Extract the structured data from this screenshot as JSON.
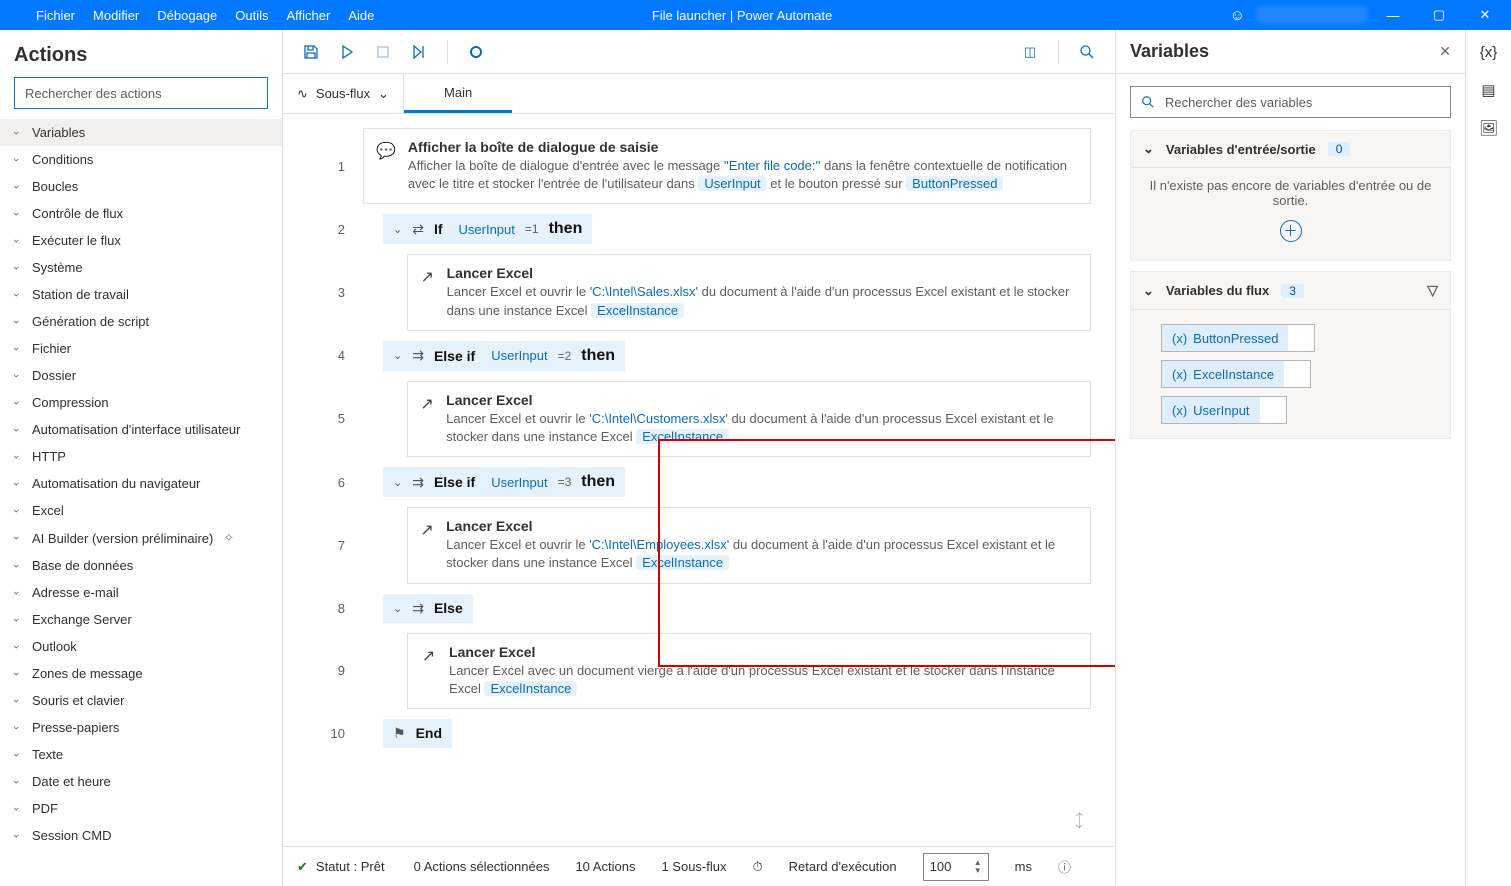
{
  "titlebar": {
    "menus": [
      "Fichier",
      "Modifier",
      "Débogage",
      "Outils",
      "Afficher",
      "Aide"
    ],
    "title": "File launcher | Power Automate"
  },
  "left": {
    "title": "Actions",
    "search_placeholder": "Rechercher des actions",
    "categories": [
      "Variables",
      "Conditions",
      "Boucles",
      "Contrôle de flux",
      "Exécuter le flux",
      "Système",
      "Station de travail",
      "Génération de script",
      "Fichier",
      "Dossier",
      "Compression",
      "Automatisation d'interface utilisateur",
      "HTTP",
      "Automatisation du navigateur",
      "Excel",
      "AI Builder (version préliminaire)",
      "Base de données",
      "Adresse e-mail",
      "Exchange Server",
      "Outlook",
      "Zones de message",
      "Souris et clavier",
      "Presse-papiers",
      "Texte",
      "Date et heure",
      "PDF",
      "Session CMD"
    ],
    "preview_index": 15
  },
  "mid": {
    "subflow_label": "Sous-flux",
    "tab_label": "Main",
    "steps": {
      "s1": {
        "title": "Afficher la boîte de dialogue de saisie",
        "d1": "Afficher la boîte de dialogue d'entrée avec le message ",
        "lit1": "''Enter file code:''",
        "d2": " dans la fenêtre contextuelle de notification avec le titre  et stocker l'entrée de l'utilisateur dans ",
        "tok1": "UserInput",
        "d3": " et le bouton pressé sur ",
        "tok2": "ButtonPressed"
      },
      "s2": {
        "kw": "If",
        "tok": "UserInput",
        "op": "=1",
        "then": "then"
      },
      "s3": {
        "title": "Lancer Excel",
        "d1": "Lancer Excel et ouvrir le ",
        "lit": "'C:\\Intel\\Sales.xlsx'",
        "d2": " du document à l'aide d'un processus Excel existant et le stocker dans une instance Excel ",
        "tok": "ExcelInstance"
      },
      "s4": {
        "kw": "Else if",
        "tok": "UserInput",
        "op": "=2",
        "then": "then"
      },
      "s5": {
        "title": "Lancer Excel",
        "d1": "Lancer Excel et ouvrir le ",
        "lit": "'C:\\Intel\\Customers.xlsx'",
        "d2": " du document à l'aide d'un processus Excel existant et le stocker dans une instance Excel ",
        "tok": "ExcelInstance"
      },
      "s6": {
        "kw": "Else if",
        "tok": "UserInput",
        "op": "=3",
        "then": "then"
      },
      "s7": {
        "title": "Lancer Excel",
        "d1": "Lancer Excel et ouvrir le ",
        "lit": "'C:\\Intel\\Employees.xlsx'",
        "d2": " du document à l'aide d'un processus Excel existant et le stocker dans une instance Excel ",
        "tok": "ExcelInstance"
      },
      "s8": {
        "kw": "Else"
      },
      "s9": {
        "title": "Lancer Excel",
        "d1": "Lancer Excel avec un document vierge à l'aide d'un processus Excel existant et le stocker dans l'instance Excel ",
        "tok": "ExcelInstance"
      },
      "s10": {
        "kw": "End"
      }
    }
  },
  "status": {
    "ready": "Statut : Prêt",
    "sel": "0 Actions sélectionnées",
    "acts": "10 Actions",
    "sub": "1 Sous-flux",
    "delay_label": "Retard d'exécution",
    "delay_value": "100",
    "ms": "ms"
  },
  "right": {
    "title": "Variables",
    "search_placeholder": "Rechercher des variables",
    "io_title": "Variables d'entrée/sortie",
    "io_count": "0",
    "io_empty": "Il n'existe pas encore de variables d'entrée ou de sortie.",
    "flow_title": "Variables du flux",
    "flow_count": "3",
    "vars": [
      "ButtonPressed",
      "ExcelInstance",
      "UserInput"
    ]
  }
}
